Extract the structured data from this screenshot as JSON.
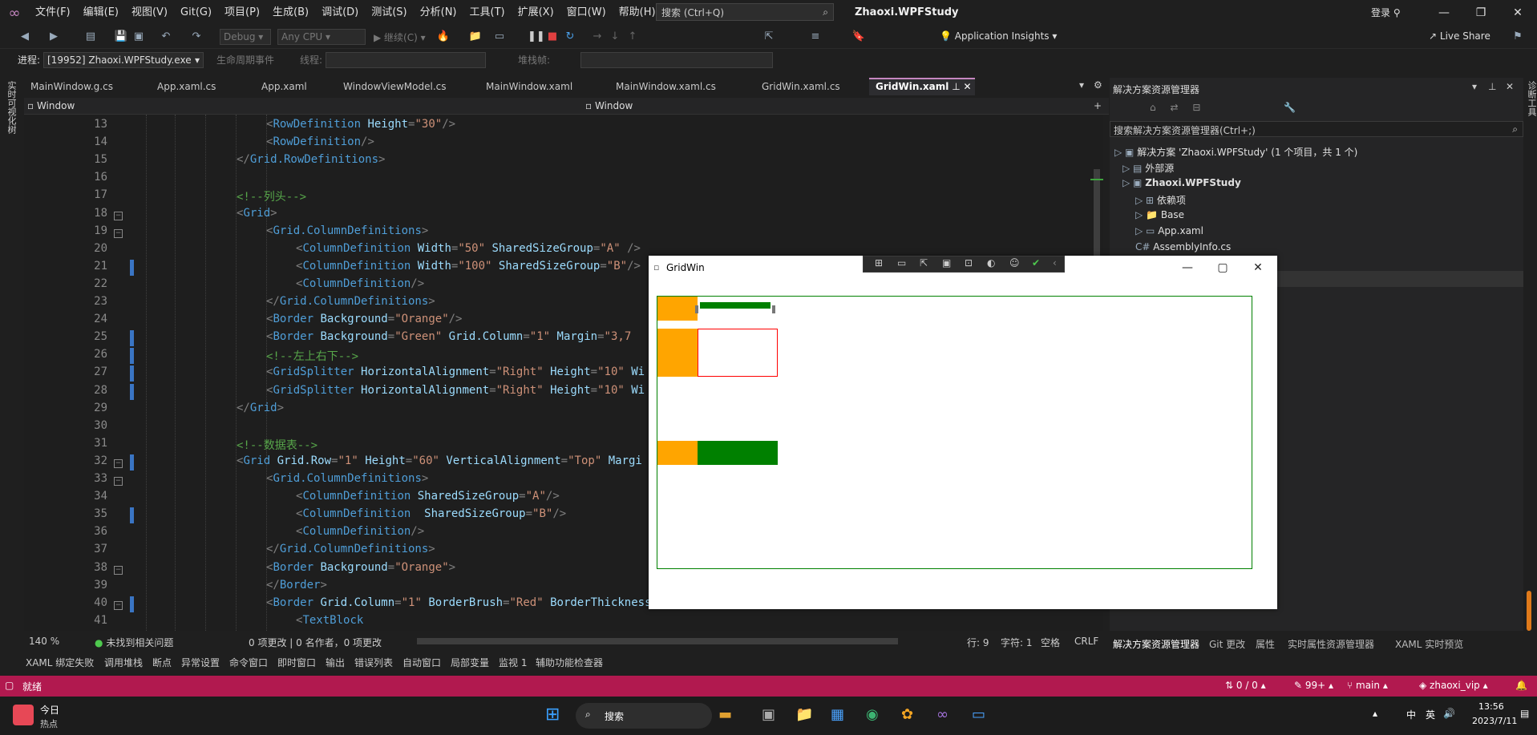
{
  "titlebar": {
    "menus": [
      "文件(F)",
      "编辑(E)",
      "视图(V)",
      "Git(G)",
      "项目(P)",
      "生成(B)",
      "调试(D)",
      "测试(S)",
      "分析(N)",
      "工具(T)",
      "扩展(X)",
      "窗口(W)",
      "帮助(H)"
    ],
    "search_placeholder": "搜索 (Ctrl+Q)",
    "app_title": "Zhaoxi.WPFStudy",
    "login": "登录"
  },
  "toolbar": {
    "config": "Debug",
    "platform": "Any CPU",
    "continue": "继续(C)",
    "app_insights": "Application Insights",
    "live_share": "Live Share",
    "process_label": "进程:",
    "process_value": "[19952] Zhaoxi.WPFStudy.exe",
    "lifecycle": "生命周期事件",
    "thread": "线程:",
    "stackframe": "堆栈帧:"
  },
  "tabs": [
    {
      "label": "MainWindow.g.cs",
      "active": false
    },
    {
      "label": "App.xaml.cs",
      "active": false
    },
    {
      "label": "App.xaml",
      "active": false
    },
    {
      "label": "WindowViewModel.cs",
      "active": false
    },
    {
      "label": "MainWindow.xaml",
      "active": false
    },
    {
      "label": "MainWindow.xaml.cs",
      "active": false
    },
    {
      "label": "GridWin.xaml.cs",
      "active": false
    },
    {
      "label": "GridWin.xaml",
      "active": true
    }
  ],
  "navbar": {
    "left": "Window",
    "right": "Window"
  },
  "code_lines": [
    {
      "n": "13",
      "text": "<RowDefinition Height=\"30\"/>"
    },
    {
      "n": "14",
      "text": "<RowDefinition/>"
    },
    {
      "n": "15",
      "text": "</Grid.RowDefinitions>"
    },
    {
      "n": "16",
      "text": ""
    },
    {
      "n": "17",
      "text": "<!--列头-->"
    },
    {
      "n": "18",
      "text": "<Grid>"
    },
    {
      "n": "19",
      "text": "<Grid.ColumnDefinitions>"
    },
    {
      "n": "20",
      "text": "<ColumnDefinition Width=\"50\" SharedSizeGroup=\"A\" />"
    },
    {
      "n": "21",
      "text": "<ColumnDefinition Width=\"100\" SharedSizeGroup=\"B\"/>"
    },
    {
      "n": "22",
      "text": "<ColumnDefinition/>"
    },
    {
      "n": "23",
      "text": "</Grid.ColumnDefinitions>"
    },
    {
      "n": "24",
      "text": "<Border Background=\"Orange\"/>"
    },
    {
      "n": "25",
      "text": "<Border Background=\"Green\" Grid.Column=\"1\" Margin=\"3,7"
    },
    {
      "n": "26",
      "text": "<!--左上右下-->"
    },
    {
      "n": "27",
      "text": "<GridSplitter HorizontalAlignment=\"Right\" Height=\"10\" Wi"
    },
    {
      "n": "28",
      "text": "<GridSplitter HorizontalAlignment=\"Right\" Height=\"10\" Wi"
    },
    {
      "n": "29",
      "text": "</Grid>"
    },
    {
      "n": "30",
      "text": ""
    },
    {
      "n": "31",
      "text": "<!--数据表-->"
    },
    {
      "n": "32",
      "text": "<Grid Grid.Row=\"1\" Height=\"60\" VerticalAlignment=\"Top\" Margi"
    },
    {
      "n": "33",
      "text": "<Grid.ColumnDefinitions>"
    },
    {
      "n": "34",
      "text": "<ColumnDefinition SharedSizeGroup=\"A\"/>"
    },
    {
      "n": "35",
      "text": "<ColumnDefinition  SharedSizeGroup=\"B\"/>"
    },
    {
      "n": "36",
      "text": "<ColumnDefinition/>"
    },
    {
      "n": "37",
      "text": "</Grid.ColumnDefinitions>"
    },
    {
      "n": "38",
      "text": "<Border Background=\"Orange\">"
    },
    {
      "n": "39",
      "text": "</Border>"
    },
    {
      "n": "40",
      "text": "<Border Grid.Column=\"1\" BorderBrush=\"Red\" BorderThickness=\"1\">"
    },
    {
      "n": "41",
      "text": "<TextBlock"
    }
  ],
  "editor_status": {
    "zoom": "140 %",
    "issues": "未找到相关问题",
    "changes": "0 项更改 | 0 名作者，0 项更改",
    "line": "行: 9",
    "col": "字符: 1",
    "space": "空格",
    "eol": "CRLF"
  },
  "solution_explorer": {
    "title": "解决方案资源管理器",
    "search": "搜索解决方案资源管理器(Ctrl+;)",
    "items": [
      "解决方案 'Zhaoxi.WPFStudy' (1 个项目，共 1 个)",
      "外部源",
      "Zhaoxi.WPFStudy",
      "依赖项",
      "Base",
      "App.xaml",
      "AssemblyInfo.cs"
    ],
    "bottom_tabs": [
      "解决方案资源管理器",
      "Git 更改",
      "属性",
      "实时属性资源管理器",
      "XAML 实时预览"
    ]
  },
  "bottom_tabs": [
    "XAML 绑定失败",
    "调用堆栈",
    "断点",
    "异常设置",
    "命令窗口",
    "即时窗口",
    "输出",
    "错误列表",
    "自动窗口",
    "局部变量",
    "监视 1",
    "辅助功能检查器"
  ],
  "statusbar": {
    "ready": "就绪",
    "sync": "0 / 0",
    "edits": "99+",
    "branch": "main",
    "user": "zhaoxi_vip"
  },
  "taskbar": {
    "news_title": "今日",
    "news_sub": "热点",
    "search": "搜索",
    "ime": "中",
    "ime2": "英",
    "time": "13:56",
    "date": "2023/7/11"
  },
  "wpf_window": {
    "title": "GridWin"
  },
  "left_sidebar": "实时可视化树",
  "right_sidebar": "诊断工具",
  "colors": {
    "accent": "#b1194f",
    "orange": "#ffa500",
    "green": "#008000",
    "red": "#ff0000"
  }
}
